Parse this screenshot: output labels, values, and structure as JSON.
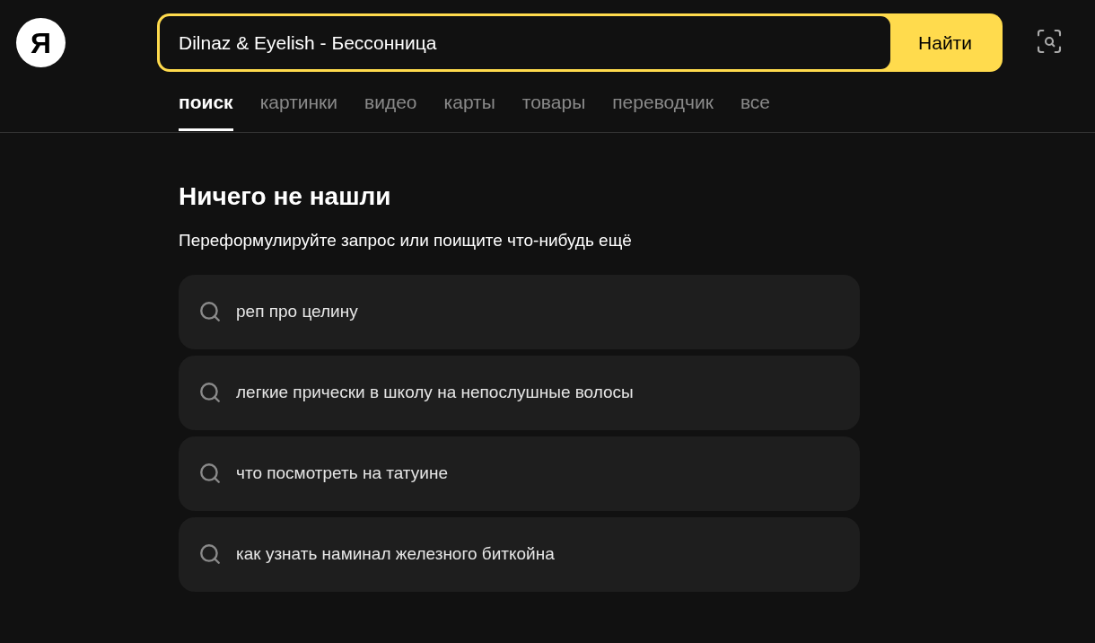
{
  "search": {
    "value": "Dilnaz & Eyelish - Бессонница",
    "button": "Найти"
  },
  "logo": {
    "text": "Я"
  },
  "tabs": [
    {
      "label": "поиск",
      "selected": true
    },
    {
      "label": "картинки",
      "selected": false
    },
    {
      "label": "видео",
      "selected": false
    },
    {
      "label": "карты",
      "selected": false
    },
    {
      "label": "товары",
      "selected": false
    },
    {
      "label": "переводчик",
      "selected": false
    },
    {
      "label": "все",
      "selected": false
    }
  ],
  "empty_state": {
    "title": "Ничего не нашли",
    "subtitle": "Переформулируйте запрос или поищите что-нибудь ещё"
  },
  "suggestions": [
    "реп про целину",
    "легкие прически в школу на непослушные волосы",
    "что посмотреть на татуине",
    "как узнать наминал железного биткойна"
  ]
}
